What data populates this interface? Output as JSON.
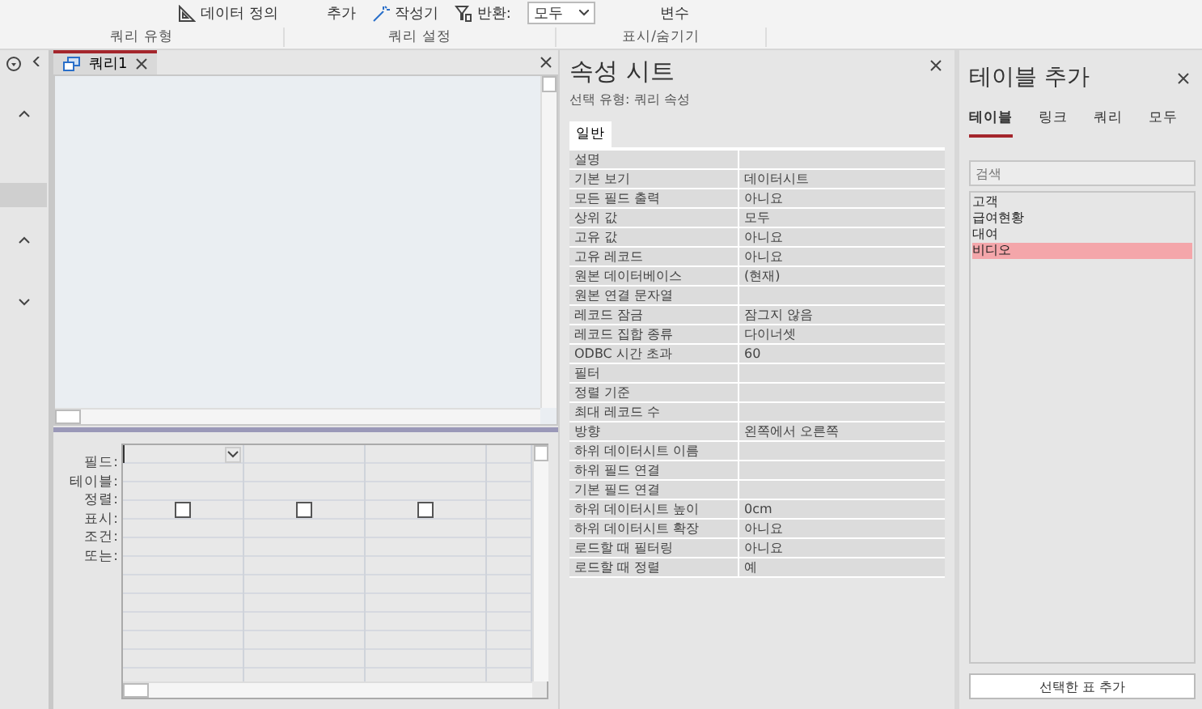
{
  "ribbon": {
    "items": [
      {
        "kind": "icon-button",
        "label": "데이터 정의"
      },
      {
        "kind": "text",
        "label": "추가"
      },
      {
        "kind": "icon-button",
        "label": "작성기"
      },
      {
        "kind": "select",
        "label": "반환:",
        "value": "모두"
      },
      {
        "kind": "text",
        "label": "변수"
      }
    ],
    "groups": [
      "쿼리 유형",
      "쿼리 설정",
      "표시/숨기기"
    ]
  },
  "query_window": {
    "tab": {
      "label": "쿼리1",
      "selected": true
    },
    "grid": {
      "row_labels": [
        "필드:",
        "테이블:",
        "정렬:",
        "표시:",
        "조건:",
        "또는:"
      ],
      "columns": [
        {
          "checked": false
        },
        {
          "checked": false
        },
        {
          "checked": false
        }
      ]
    }
  },
  "property_sheet": {
    "title": "속성 시트",
    "subtitle": "선택 유형: 쿼리 속성",
    "tabs": [
      {
        "label": "일반",
        "selected": true
      }
    ],
    "rows": [
      [
        "설명",
        ""
      ],
      [
        "기본 보기",
        "데이터시트"
      ],
      [
        "모든 필드 출력",
        "아니요"
      ],
      [
        "상위 값",
        "모두"
      ],
      [
        "고유 값",
        "아니요"
      ],
      [
        "고유 레코드",
        "아니요"
      ],
      [
        "원본 데이터베이스",
        "(현재)"
      ],
      [
        "원본 연결 문자열",
        ""
      ],
      [
        "레코드 잠금",
        "잠그지 않음"
      ],
      [
        "레코드 집합 종류",
        "다이너셋"
      ],
      [
        "ODBC 시간 초과",
        "60"
      ],
      [
        "필터",
        ""
      ],
      [
        "정렬 기준",
        ""
      ],
      [
        "최대 레코드 수",
        ""
      ],
      [
        "방향",
        "왼쪽에서 오른쪽"
      ],
      [
        "하위 데이터시트 이름",
        ""
      ],
      [
        "하위 필드 연결",
        ""
      ],
      [
        "기본 필드 연결",
        ""
      ],
      [
        "하위 데이터시트 높이",
        "0cm"
      ],
      [
        "하위 데이터시트 확장",
        "아니요"
      ],
      [
        "로드할 때 필터링",
        "아니요"
      ],
      [
        "로드할 때 정렬",
        "예"
      ]
    ]
  },
  "add_tables": {
    "title": "테이블 추가",
    "tabs": [
      {
        "label": "테이블",
        "selected": true
      },
      {
        "label": "링크",
        "selected": false
      },
      {
        "label": "쿼리",
        "selected": false
      },
      {
        "label": "모두",
        "selected": false
      }
    ],
    "search": {
      "placeholder": "검색"
    },
    "items": [
      {
        "label": "고객",
        "selected": false
      },
      {
        "label": "급여현황",
        "selected": false
      },
      {
        "label": "대여",
        "selected": false
      },
      {
        "label": "비디오",
        "selected": true
      }
    ],
    "button": "선택한 표 추가"
  }
}
